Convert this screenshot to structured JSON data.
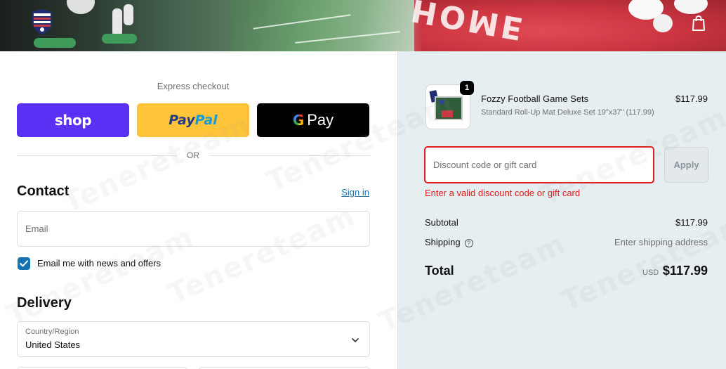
{
  "header": {
    "logo_icon": "shield-logo-icon",
    "cart_icon": "shopping-bag-icon",
    "banner_word": "HOME"
  },
  "express": {
    "label": "Express checkout",
    "shop_label": "shop",
    "paypal_label_pay": "Pay",
    "paypal_label_pal": "Pal",
    "gpay_g": "G",
    "gpay_label": "Pay",
    "divider_label": "OR"
  },
  "contact": {
    "title": "Contact",
    "signin_label": "Sign in",
    "email_placeholder": "Email",
    "newsletter_label": "Email me with news and offers",
    "newsletter_checked": true
  },
  "delivery": {
    "title": "Delivery",
    "country_label": "Country/Region",
    "country_value": "United States"
  },
  "order": {
    "product": {
      "title": "Fozzy Football Game Sets",
      "variant": "Standard Roll-Up Mat Deluxe Set 19\"x37\" (117.99)",
      "price": "$117.99",
      "quantity": "1"
    },
    "discount_placeholder": "Discount code or gift card",
    "apply_label": "Apply",
    "discount_error": "Enter a valid discount code or gift card",
    "subtotal_label": "Subtotal",
    "subtotal_value": "$117.99",
    "shipping_label": "Shipping",
    "shipping_value": "Enter shipping address",
    "total_label": "Total",
    "total_currency": "USD",
    "total_value": "$117.99"
  },
  "watermark": {
    "text": "Tenereteam"
  },
  "colors": {
    "shop_purple": "#5a31f4",
    "paypal_yellow": "#ffc439",
    "link_blue": "#1773b0",
    "error_red": "#dd1d1d",
    "summary_bg": "#e6eef2"
  }
}
